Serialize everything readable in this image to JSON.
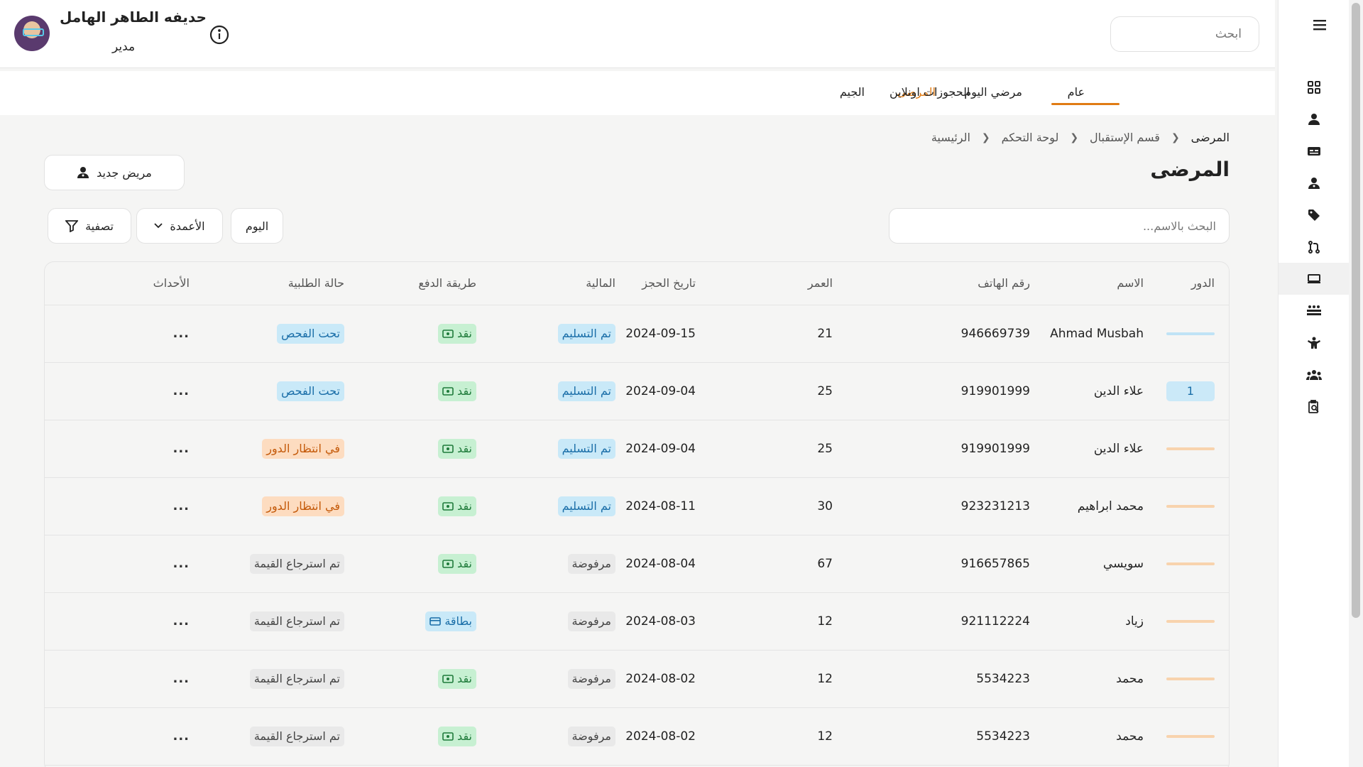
{
  "header": {
    "user_name": "حديفه الطاهر الهامل",
    "user_role": "مدير",
    "search_placeholder": "ابحث"
  },
  "tabs": [
    {
      "label": "عام"
    },
    {
      "label": "مرضي اليوم"
    },
    {
      "label": "المرضى"
    },
    {
      "label": "الجيم"
    },
    {
      "label": "الحجوزات اونلاين"
    }
  ],
  "active_tab": "المرضى",
  "breadcrumb": [
    "الرئيسية",
    "لوحة التحكم",
    "قسم الإستقبال",
    "المرضى"
  ],
  "page_title": "المرضى",
  "toolbar": {
    "new_patient": "مريض جديد",
    "name_search_placeholder": "البحث بالاسم...",
    "today": "اليوم",
    "columns": "الأعمدة",
    "filter": "تصفية"
  },
  "table": {
    "headers": [
      "الدور",
      "الاسم",
      "رقم الهاتف",
      "العمر",
      "تاريخ الحجز",
      "المالية",
      "طريقة الدفع",
      "حالة الطلبية",
      "الأحداث"
    ],
    "rows": [
      {
        "order": "",
        "name": "Ahmad Musbah",
        "phone": "946669739",
        "age": "21",
        "date": "2024-09-15",
        "finance": "تم التسليم",
        "payment": "نقد",
        "status": "تحت الفحص"
      },
      {
        "order": "1",
        "name": "علاء الدين",
        "phone": "919901999",
        "age": "25",
        "date": "2024-09-04",
        "finance": "تم التسليم",
        "payment": "نقد",
        "status": "تحت الفحص"
      },
      {
        "order": "",
        "name": "علاء الدين",
        "phone": "919901999",
        "age": "25",
        "date": "2024-09-04",
        "finance": "تم التسليم",
        "payment": "نقد",
        "status": "في انتظار الدور"
      },
      {
        "order": "",
        "name": "محمد ابراهيم",
        "phone": "923231213",
        "age": "30",
        "date": "2024-08-11",
        "finance": "تم التسليم",
        "payment": "نقد",
        "status": "في انتظار الدور"
      },
      {
        "order": "",
        "name": "سويسي",
        "phone": "916657865",
        "age": "67",
        "date": "2024-08-04",
        "finance": "مرفوضة",
        "payment": "نقد",
        "status": "تم استرجاع القيمة"
      },
      {
        "order": "",
        "name": "زياد",
        "phone": "921112224",
        "age": "12",
        "date": "2024-08-03",
        "finance": "مرفوضة",
        "payment": "بطاقة",
        "status": "تم استرجاع القيمة"
      },
      {
        "order": "",
        "name": "محمد",
        "phone": "5534223",
        "age": "12",
        "date": "2024-08-02",
        "finance": "مرفوضة",
        "payment": "نقد",
        "status": "تم استرجاع القيمة"
      },
      {
        "order": "",
        "name": "محمد",
        "phone": "5534223",
        "age": "12",
        "date": "2024-08-02",
        "finance": "مرفوضة",
        "payment": "نقد",
        "status": "تم استرجاع القيمة"
      }
    ],
    "actions_label": "..."
  },
  "sidebar": {
    "icons": [
      "dashboard-icon",
      "user-icon",
      "id-card-icon",
      "doctor-icon",
      "tag-icon",
      "git-pull-request-icon",
      "monitor-icon",
      "beds-icon",
      "gym-icon",
      "team-icon",
      "clipboard-search-icon"
    ],
    "active_index": 6
  },
  "colors": {
    "accent": "#e07b14",
    "badge_blue": "#c9e9f8",
    "badge_green": "#c7f0d2",
    "badge_orange": "#fddcc0",
    "badge_gray": "#e9e9e9"
  }
}
